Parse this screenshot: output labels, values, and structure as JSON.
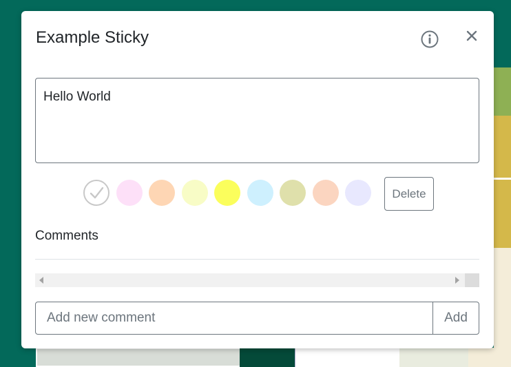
{
  "modal": {
    "title": "Example Sticky",
    "info_icon": "info-circle-icon",
    "close_icon": "close-x-icon"
  },
  "note": {
    "text": "Hello World"
  },
  "colors": {
    "swatches": [
      {
        "name": "none",
        "color": "#ffffff",
        "selected": true
      },
      {
        "name": "pink",
        "color": "#fde0f8",
        "selected": false
      },
      {
        "name": "peach",
        "color": "#fed6b4",
        "selected": false
      },
      {
        "name": "light-yellow",
        "color": "#f8fcc6",
        "selected": false
      },
      {
        "name": "yellow",
        "color": "#fbfe5c",
        "selected": false
      },
      {
        "name": "light-blue",
        "color": "#cef0fe",
        "selected": false
      },
      {
        "name": "olive",
        "color": "#dfe0ab",
        "selected": false
      },
      {
        "name": "salmon",
        "color": "#fbd5c0",
        "selected": false
      },
      {
        "name": "lavender",
        "color": "#e8e8fe",
        "selected": false
      }
    ],
    "check_icon": "check-icon"
  },
  "actions": {
    "delete_label": "Delete"
  },
  "comments": {
    "heading": "Comments",
    "input_placeholder": "Add new comment",
    "input_value": "",
    "add_label": "Add"
  },
  "theme": {
    "background": "#03695a",
    "border": "#6c757d",
    "text": "#212529"
  }
}
